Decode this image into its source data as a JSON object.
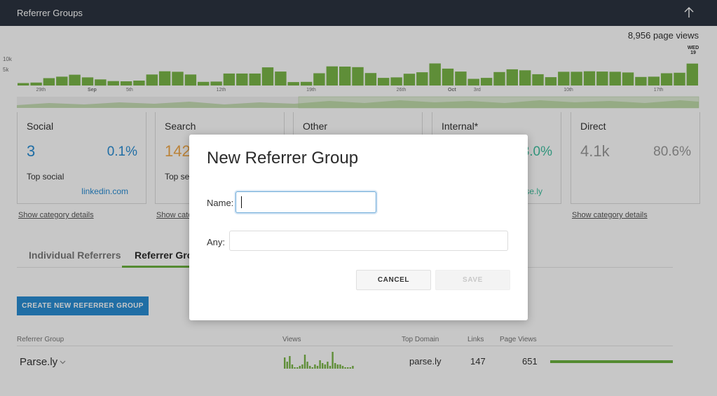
{
  "topbar": {
    "title": "Referrer Groups",
    "icon": "arrow-up-icon"
  },
  "chart": {
    "pageviews_label": "8,956 page views",
    "highlight_day": "WED",
    "highlight_date": "19",
    "y_ticks": [
      "10k",
      "5k"
    ],
    "x_ticks": [
      "29th",
      "Sep",
      "5th",
      "12th",
      "19th",
      "26th",
      "Oct",
      "3rd",
      "10th",
      "17th"
    ],
    "bar_color": "#7ab648"
  },
  "chart_data": {
    "type": "bar",
    "title": "",
    "xlabel": "",
    "ylabel": "",
    "categories": [
      "Aug 26",
      "Aug 27",
      "Aug 28",
      "Aug 29",
      "Aug 30",
      "Aug 31",
      "Sep 1",
      "Sep 2",
      "Sep 3",
      "Sep 4",
      "Sep 5",
      "Sep 6",
      "Sep 7",
      "Sep 8",
      "Sep 9",
      "Sep 10",
      "Sep 11",
      "Sep 12",
      "Sep 13",
      "Sep 14",
      "Sep 15",
      "Sep 16",
      "Sep 17",
      "Sep 18",
      "Sep 19",
      "Sep 20",
      "Sep 21",
      "Sep 22",
      "Sep 23",
      "Sep 24",
      "Sep 25",
      "Sep 26",
      "Sep 27",
      "Sep 28",
      "Sep 29",
      "Sep 30",
      "Oct 1",
      "Oct 2",
      "Oct 3",
      "Oct 4",
      "Oct 5",
      "Oct 6",
      "Oct 7",
      "Oct 8",
      "Oct 9",
      "Oct 10",
      "Oct 11",
      "Oct 12",
      "Oct 13",
      "Oct 14",
      "Oct 15",
      "Oct 16",
      "Oct 17",
      "Oct 18",
      "Oct 19"
    ],
    "values": [
      1000,
      1200,
      3000,
      3600,
      4400,
      3300,
      2500,
      1800,
      1700,
      2000,
      4500,
      5800,
      5600,
      4500,
      1500,
      1600,
      4900,
      4900,
      4900,
      7400,
      5700,
      1400,
      1500,
      5000,
      7800,
      7700,
      7500,
      5100,
      3100,
      3300,
      4800,
      5400,
      9000,
      6900,
      5700,
      2700,
      3100,
      5500,
      6600,
      6200,
      4600,
      3400,
      5600,
      5600,
      5800,
      5700,
      5600,
      5300,
      3500,
      3600,
      5000,
      5200,
      8956
    ],
    "ylim": [
      0,
      12000
    ],
    "y_ticks": [
      "10k",
      "5k"
    ],
    "grid": false,
    "legend": "none"
  },
  "cards": [
    {
      "name": "Social",
      "count": "3",
      "pct": "0.1%",
      "top_label": "Top social",
      "top_link": "linkedin.com",
      "color": "#2a8dd4"
    },
    {
      "name": "Search",
      "count": "142",
      "pct": "",
      "top_label": "Top se",
      "top_link": "",
      "color": "#f0a84a"
    },
    {
      "name": "Other",
      "count": "",
      "pct": "",
      "top_label": "",
      "top_link": "",
      "color": "#888888"
    },
    {
      "name": "Internal*",
      "count": "",
      "pct": "3.0%",
      "top_label": "",
      "top_link": "se.ly",
      "color": "#3fbf9f"
    },
    {
      "name": "Direct",
      "count": "4.1k",
      "pct": "80.6%",
      "top_label": "",
      "top_link": "",
      "color": "#9a9a9a"
    }
  ],
  "show_details": [
    "Show category details",
    "Show cate",
    "Show category details"
  ],
  "tabs": {
    "individual": "Individual Referrers",
    "groups": "Referrer Grou"
  },
  "create_button": "CREATE NEW REFERRER GROUP",
  "table": {
    "headers": {
      "group": "Referrer Group",
      "views": "Views",
      "top_domain": "Top Domain",
      "links": "Links",
      "page_views": "Page Views"
    },
    "rows": [
      {
        "name": "Parse.ly",
        "top_domain": "parse.ly",
        "links": "147",
        "page_views": "651",
        "bar_fraction": 1.0
      }
    ],
    "sparkline": [
      8,
      5,
      9,
      3,
      1,
      1,
      2,
      3,
      10,
      5,
      2,
      1,
      3,
      2,
      6,
      4,
      3,
      5,
      2,
      12,
      4,
      3,
      3,
      2,
      1,
      1,
      1,
      2
    ]
  },
  "modal": {
    "title": "New Referrer Group",
    "name_label": "Name:",
    "name_value": "",
    "any_label": "Any:",
    "any_value": "",
    "cancel": "CANCEL",
    "save": "SAVE"
  }
}
